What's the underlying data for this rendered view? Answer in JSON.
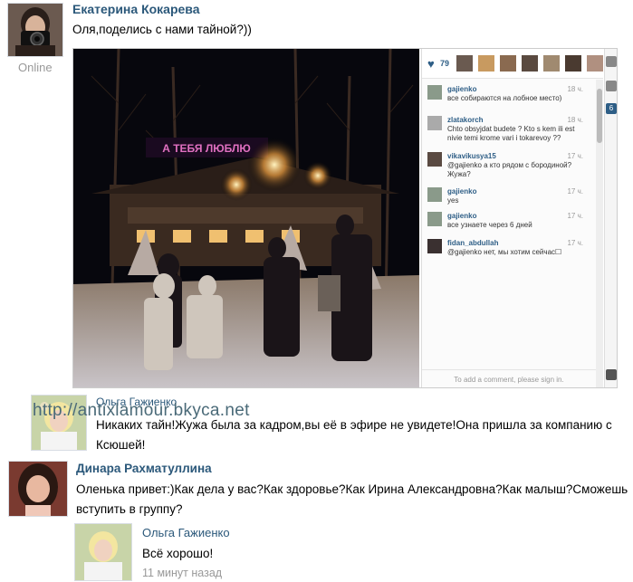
{
  "post": {
    "author": "Екатерина Кокарева",
    "status": "Online",
    "text": "Оля,поделись с нами тайной?))"
  },
  "embed": {
    "likes": "79",
    "sign_text": "А ТЕБЯ ЛЮБЛЮ",
    "comments": [
      {
        "user": "gajienko",
        "text": "все собираются на лобное место)",
        "time": "18 ч."
      },
      {
        "user": "zlatakorch",
        "text": "Chto obsyjdat budete ? Kto s kem ili est nivie temi krome vari i tokarevoy ??",
        "time": "18 ч."
      },
      {
        "user": "vikavikusya15",
        "text": "@gajienko а кто рядом с бородиной? Жужа?",
        "time": "17 ч."
      },
      {
        "user": "gajienko",
        "text": "yes",
        "time": "17 ч."
      },
      {
        "user": "gajienko",
        "text": "все узнаете через 6 дней",
        "time": "17 ч."
      },
      {
        "user": "fidan_abdullah",
        "text": "@gajienko нет, мы хотим сейчас☐",
        "time": "17 ч."
      }
    ],
    "add_comment": "To add a comment, please sign in.",
    "badge": "6"
  },
  "watermark": "http://antixlamour.bkyca.net",
  "replies": [
    {
      "author": "Ольга Гажиенко",
      "text": "Никаких тайн!Жужа была за кадром,вы её в эфире не увидете!Она пришла за компанию с Ксюшей!"
    },
    {
      "author": "Динара Рахматуллина",
      "text": "Оленька привет:)Как дела у вас?Как здоровье?Как Ирина Александровна?Как малыш?Сможешь вступить в группу?"
    },
    {
      "author": "Ольга Гажиенко",
      "text": "Всё хорошо!",
      "time": "11 минут назад"
    }
  ]
}
